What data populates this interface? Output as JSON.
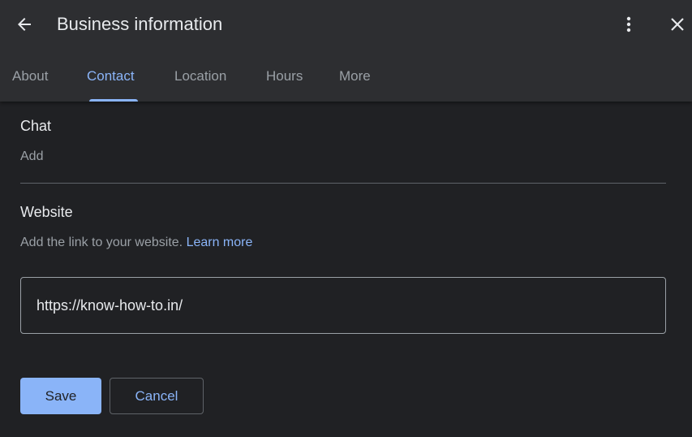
{
  "header": {
    "title": "Business information",
    "back_icon": "arrow-left-icon",
    "more_icon": "more-vert-icon",
    "close_icon": "close-icon"
  },
  "tabs": [
    {
      "label": "About",
      "active": false
    },
    {
      "label": "Contact",
      "active": true
    },
    {
      "label": "Location",
      "active": false
    },
    {
      "label": "Hours",
      "active": false
    },
    {
      "label": "More",
      "active": false
    }
  ],
  "chat": {
    "title": "Chat",
    "add_label": "Add"
  },
  "website": {
    "title": "Website",
    "description": "Add the link to your website.",
    "learn_more": "Learn more",
    "value": "https://know-how-to.in/"
  },
  "actions": {
    "save_label": "Save",
    "cancel_label": "Cancel"
  },
  "colors": {
    "background": "#202124",
    "header_background": "#2d2e31",
    "accent": "#8ab4f8",
    "text_primary": "#e8eaed",
    "text_secondary": "#9aa0a6"
  }
}
